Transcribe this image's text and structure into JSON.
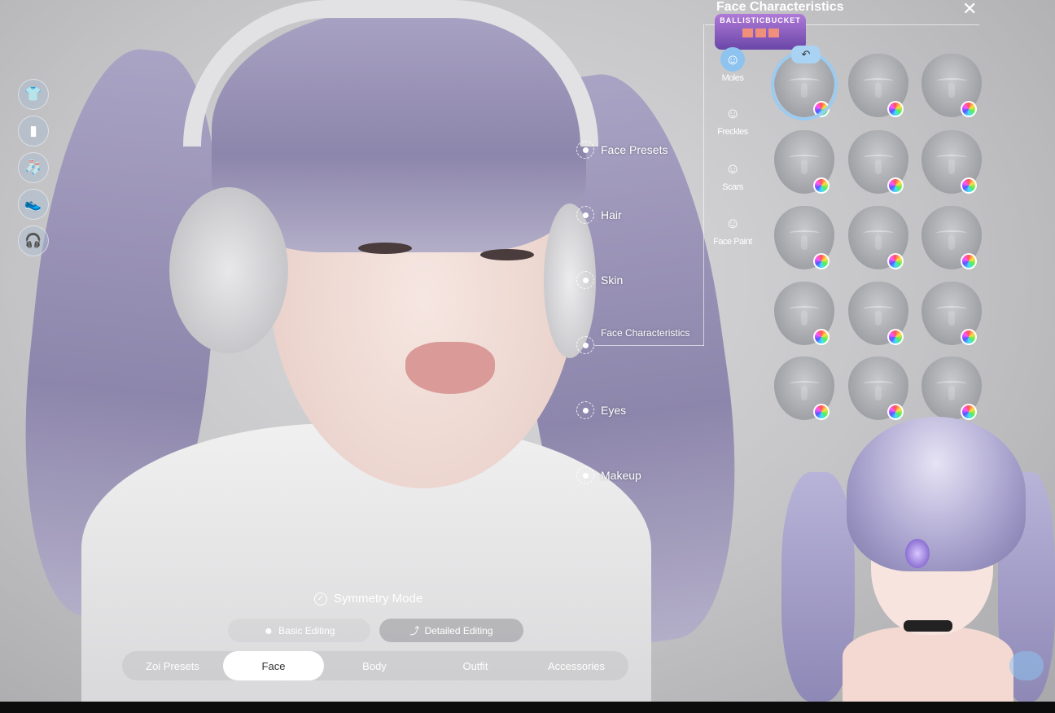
{
  "left_toolbar": {
    "items": [
      {
        "icon": "top-icon"
      },
      {
        "icon": "pants-icon"
      },
      {
        "icon": "socks-icon"
      },
      {
        "icon": "shoes-icon"
      },
      {
        "icon": "headphones-icon"
      }
    ]
  },
  "categories": [
    {
      "label": "Face Presets"
    },
    {
      "label": "Hair"
    },
    {
      "label": "Skin"
    },
    {
      "label": "Face Characteristics"
    },
    {
      "label": "Eyes"
    },
    {
      "label": "Makeup"
    }
  ],
  "panel": {
    "title": "Face Characteristics",
    "close_icon": "close-icon",
    "subtabs": [
      {
        "label": "Moles",
        "active": true
      },
      {
        "label": "Freckles"
      },
      {
        "label": "Scars"
      },
      {
        "label": "Face Paint"
      }
    ],
    "grid_rows": 5,
    "grid_cols": 3,
    "selected_index": 0,
    "reset_icon": "undo-icon"
  },
  "streamer_badge": {
    "name": "BALLISTICBUCKET"
  },
  "symmetry": {
    "label": "Symmetry Mode",
    "checked": true
  },
  "edit_modes": [
    {
      "label": "Basic Editing"
    },
    {
      "label": "Detailed Editing",
      "active": true
    }
  ],
  "tabs": [
    {
      "label": "Zoi Presets"
    },
    {
      "label": "Face",
      "active": true
    },
    {
      "label": "Body"
    },
    {
      "label": "Outfit"
    },
    {
      "label": "Accessories"
    }
  ],
  "colors": {
    "accent": "#8ec3ef",
    "hair": "#a39dc0",
    "active_tab": "#ffffff"
  }
}
